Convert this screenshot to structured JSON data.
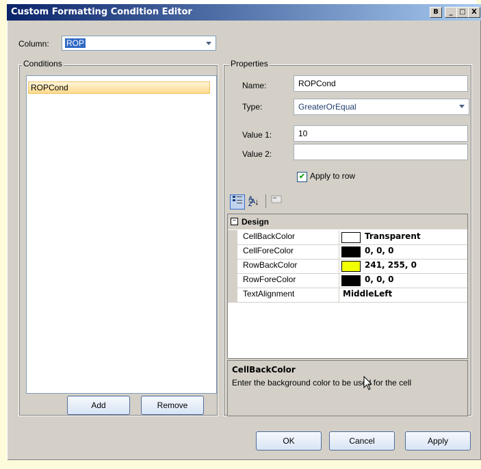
{
  "window": {
    "title": "Custom Formatting Condition Editor",
    "buttons": [
      "B",
      "_",
      "□",
      "X"
    ]
  },
  "column": {
    "label": "Column:",
    "value": "ROP"
  },
  "conditions": {
    "group_title": "Conditions",
    "items": [
      "ROPCond"
    ],
    "add_label": "Add",
    "remove_label": "Remove"
  },
  "properties": {
    "group_title": "Properties",
    "name_label": "Name:",
    "name_value": "ROPCond",
    "type_label": "Type:",
    "type_value": "GreaterOrEqual",
    "value1_label": "Value 1:",
    "value1_value": "10",
    "value2_label": "Value 2:",
    "value2_value": "",
    "apply_to_row_label": "Apply to row",
    "apply_to_row_checked": true
  },
  "grid": {
    "category": "Design",
    "rows": [
      {
        "name": "CellBackColor",
        "color": "#ffffff",
        "value": "Transparent"
      },
      {
        "name": "CellForeColor",
        "color": "#000000",
        "value": "0, 0, 0"
      },
      {
        "name": "RowBackColor",
        "color": "#f1ff00",
        "value": "241, 255, 0"
      },
      {
        "name": "RowForeColor",
        "color": "#000000",
        "value": "0, 0, 0"
      },
      {
        "name": "TextAlignment",
        "color": "",
        "value": "MiddleLeft"
      }
    ],
    "help_title": "CellBackColor",
    "help_text": "Enter the background color to be used for the cell"
  },
  "footer": {
    "ok_label": "OK",
    "cancel_label": "Cancel",
    "apply_label": "Apply"
  }
}
